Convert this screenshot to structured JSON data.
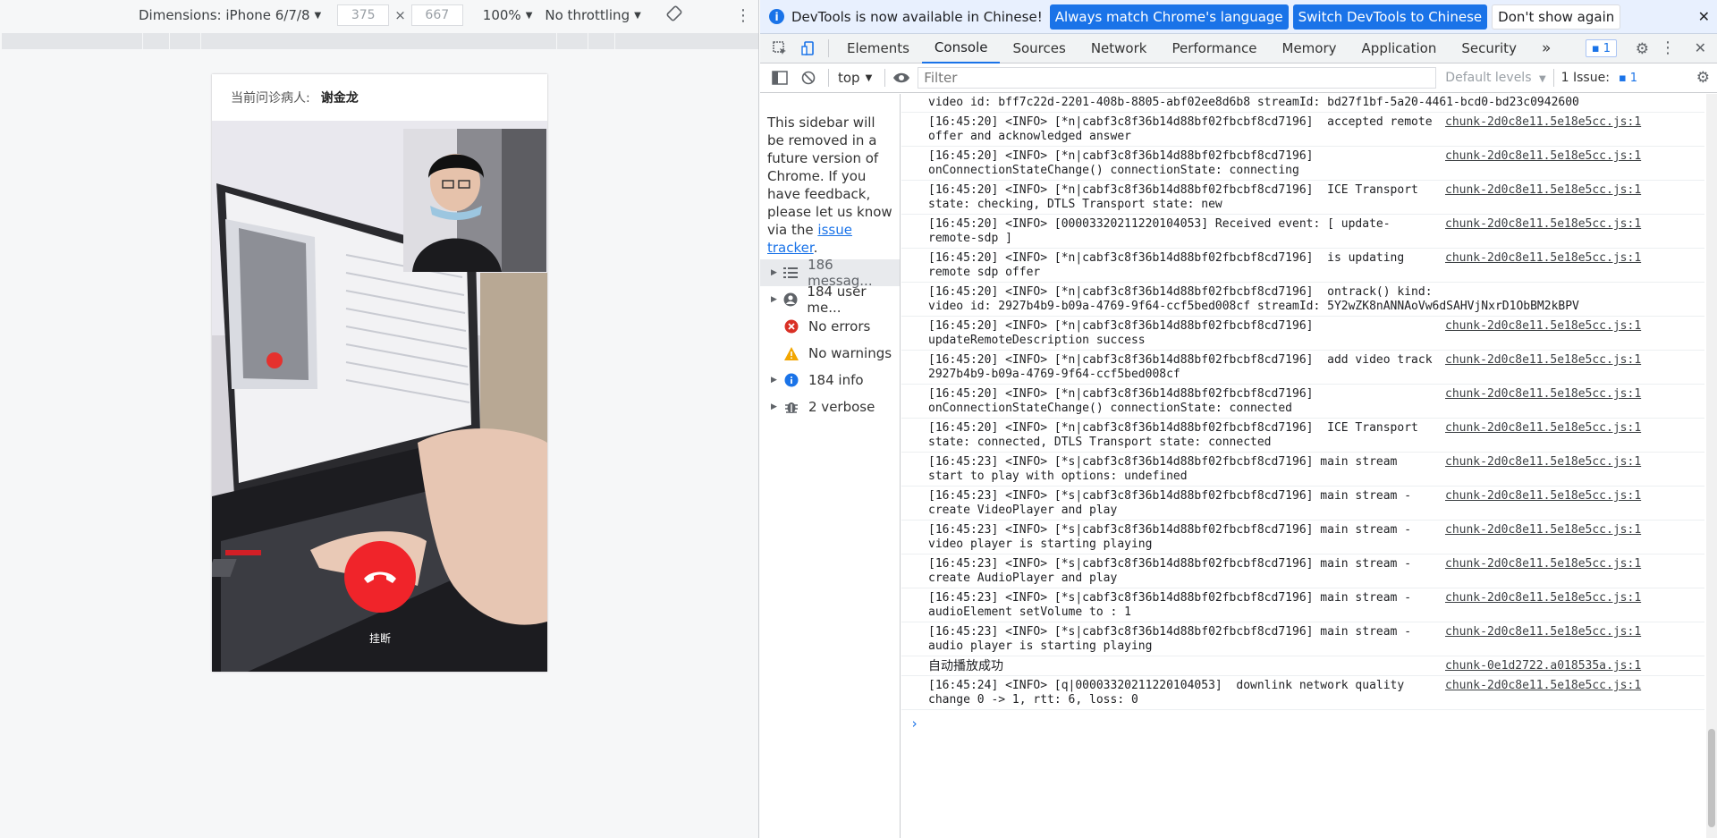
{
  "device_toolbar": {
    "dimensions_label": "Dimensions: iPhone 6/7/8",
    "width": "375",
    "height": "667",
    "times": "×",
    "zoom": "100%",
    "throttling": "No throttling"
  },
  "phone": {
    "patient_label": "当前问诊病人:",
    "patient_name": "谢金龙",
    "hangup_label": "挂断"
  },
  "infobar": {
    "message": "DevTools is now available in Chinese!",
    "btn_match": "Always match Chrome's language",
    "btn_switch": "Switch DevTools to Chinese",
    "btn_dismiss": "Don't show again"
  },
  "tabs": [
    "Elements",
    "Console",
    "Sources",
    "Network",
    "Performance",
    "Memory",
    "Application",
    "Security"
  ],
  "issues_badge": "1",
  "console_toolbar": {
    "context": "top",
    "filter_placeholder": "Filter",
    "levels": "Default levels",
    "issue_text": "1 Issue:",
    "issue_count": "1"
  },
  "sidebar": {
    "notice": "This sidebar will be removed in a future version of Chrome. If you have feedback, please let us know via the",
    "notice_link": "issue tracker",
    "items": [
      {
        "label": "186 messag..."
      },
      {
        "label": "184 user me..."
      },
      {
        "label": "No errors"
      },
      {
        "label": "No warnings"
      },
      {
        "label": "184 info"
      },
      {
        "label": "2 verbose"
      }
    ]
  },
  "log": [
    {
      "msg": "video id: bff7c22d-2201-408b-8805-abf02ee8d6b8 streamId: bd27f1bf-5a20-4461-bcd0-bd23c0942600",
      "src": ""
    },
    {
      "msg": "[16:45:20] <INFO> [*n|cabf3c8f36b14d88bf02fbcbf8cd7196]  accepted remote\noffer and acknowledged answer",
      "src": "chunk-2d0c8e11.5e18e5cc.js:1"
    },
    {
      "msg": "[16:45:20] <INFO> [*n|cabf3c8f36b14d88bf02fbcbf8cd7196]\nonConnectionStateChange() connectionState: connecting",
      "src": "chunk-2d0c8e11.5e18e5cc.js:1"
    },
    {
      "msg": "[16:45:20] <INFO> [*n|cabf3c8f36b14d88bf02fbcbf8cd7196]  ICE Transport\nstate: checking, DTLS Transport state: new",
      "src": "chunk-2d0c8e11.5e18e5cc.js:1"
    },
    {
      "msg": "[16:45:20] <INFO> [00003320211220104053] Received event: [ update-\nremote-sdp ]",
      "src": "chunk-2d0c8e11.5e18e5cc.js:1"
    },
    {
      "msg": "[16:45:20] <INFO> [*n|cabf3c8f36b14d88bf02fbcbf8cd7196]  is updating\nremote sdp offer",
      "src": "chunk-2d0c8e11.5e18e5cc.js:1"
    },
    {
      "msg": "[16:45:20] <INFO> [*n|cabf3c8f36b14d88bf02fbcbf8cd7196]  ontrack() kind:\nvideo id: 2927b4b9-b09a-4769-9f64-ccf5bed008cf streamId: 5Y2wZK8nANNAoVw6dSAHVjNxrD1ObBM2kBPV",
      "src": "chunk-2d0c8e11.5e18e5cc.js:1"
    },
    {
      "msg": "[16:45:20] <INFO> [*n|cabf3c8f36b14d88bf02fbcbf8cd7196]\nupdateRemoteDescription success",
      "src": "chunk-2d0c8e11.5e18e5cc.js:1"
    },
    {
      "msg": "[16:45:20] <INFO> [*n|cabf3c8f36b14d88bf02fbcbf8cd7196]  add video track\n2927b4b9-b09a-4769-9f64-ccf5bed008cf",
      "src": "chunk-2d0c8e11.5e18e5cc.js:1"
    },
    {
      "msg": "[16:45:20] <INFO> [*n|cabf3c8f36b14d88bf02fbcbf8cd7196]\nonConnectionStateChange() connectionState: connected",
      "src": "chunk-2d0c8e11.5e18e5cc.js:1"
    },
    {
      "msg": "[16:45:20] <INFO> [*n|cabf3c8f36b14d88bf02fbcbf8cd7196]  ICE Transport\nstate: connected, DTLS Transport state: connected",
      "src": "chunk-2d0c8e11.5e18e5cc.js:1"
    },
    {
      "msg": "[16:45:23] <INFO> [*s|cabf3c8f36b14d88bf02fbcbf8cd7196] main stream\nstart to play with options: undefined",
      "src": "chunk-2d0c8e11.5e18e5cc.js:1"
    },
    {
      "msg": "[16:45:23] <INFO> [*s|cabf3c8f36b14d88bf02fbcbf8cd7196] main stream -\ncreate VideoPlayer and play",
      "src": "chunk-2d0c8e11.5e18e5cc.js:1"
    },
    {
      "msg": "[16:45:23] <INFO> [*s|cabf3c8f36b14d88bf02fbcbf8cd7196] main stream -\nvideo player is starting playing",
      "src": "chunk-2d0c8e11.5e18e5cc.js:1"
    },
    {
      "msg": "[16:45:23] <INFO> [*s|cabf3c8f36b14d88bf02fbcbf8cd7196] main stream -\ncreate AudioPlayer and play",
      "src": "chunk-2d0c8e11.5e18e5cc.js:1"
    },
    {
      "msg": "[16:45:23] <INFO> [*s|cabf3c8f36b14d88bf02fbcbf8cd7196] main stream -\naudioElement setVolume to : 1",
      "src": "chunk-2d0c8e11.5e18e5cc.js:1"
    },
    {
      "msg": "[16:45:23] <INFO> [*s|cabf3c8f36b14d88bf02fbcbf8cd7196] main stream -\naudio player is starting playing",
      "src": "chunk-2d0c8e11.5e18e5cc.js:1"
    },
    {
      "msg": "自动播放成功",
      "src": "chunk-0e1d2722.a018535a.js:1"
    },
    {
      "msg": "[16:45:24] <INFO> [q|00003320211220104053]  downlink network quality\nchange 0 -> 1, rtt: 6, loss: 0",
      "src": "chunk-2d0c8e11.5e18e5cc.js:1"
    }
  ],
  "prompt": "›"
}
